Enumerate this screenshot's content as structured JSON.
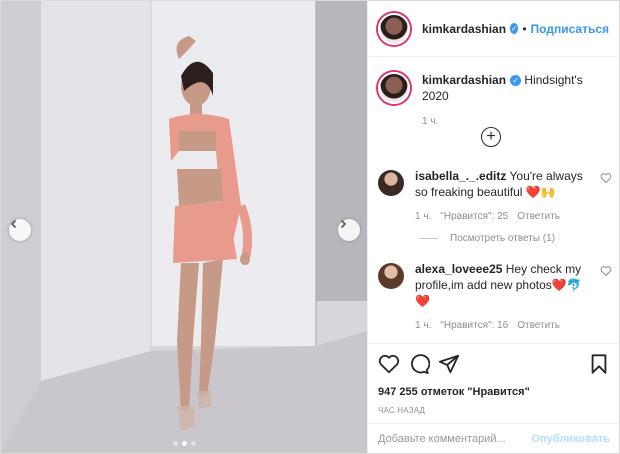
{
  "header": {
    "username": "kimkardashian",
    "separator": "•",
    "follow_label": "Подписаться"
  },
  "caption": {
    "username": "kimkardashian",
    "text": "Hindsight's 2020",
    "time": "1 ч."
  },
  "load_more_icon": "plus-circle-icon",
  "comments": [
    {
      "username": "isabella_._.editz",
      "text": "You're always so freaking beautiful ❤️🙌",
      "time": "1 ч.",
      "likes": "\"Нравится\": 25",
      "reply": "Ответить"
    },
    {
      "username": "alexa_loveee25",
      "text": "Hey check my profile,im add new photos❤️🐬❤️",
      "time": "1 ч.",
      "likes": "\"Нравится\": 16",
      "reply": "Ответить"
    }
  ],
  "view_replies": "Посмотреть ответы (1)",
  "actions": {
    "likes_count": "947 255 отметок \"Нравится\"",
    "timestamp": "ЧАС НАЗАД"
  },
  "add_comment": {
    "placeholder": "Добавьте комментарий...",
    "publish_label": "Опубликовать"
  },
  "carousel": {
    "total": 3,
    "current": 2
  },
  "colors": {
    "link": "#3897f0",
    "muted": "#8e8e8e",
    "text": "#262626"
  }
}
